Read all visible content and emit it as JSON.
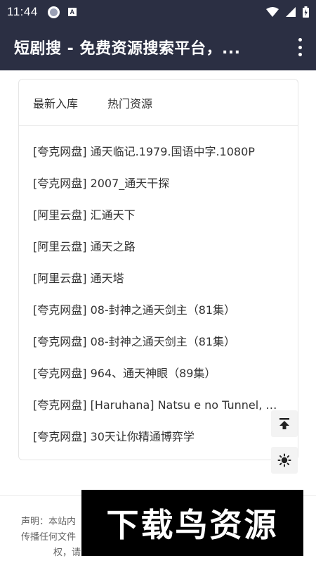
{
  "status_bar": {
    "time": "11:44"
  },
  "app_bar": {
    "title": "短剧搜 - 免费资源搜索平台，..."
  },
  "tabs": [
    {
      "label": "最新入库"
    },
    {
      "label": "热门资源"
    }
  ],
  "results": [
    {
      "label": "[夸克网盘] 通天临记.1979.国语中字.1080P"
    },
    {
      "label": "[夸克网盘] 2007_通天干探"
    },
    {
      "label": "[阿里云盘] 汇通天下"
    },
    {
      "label": "[阿里云盘] 通天之路"
    },
    {
      "label": "[阿里云盘] 通天塔"
    },
    {
      "label": "[夸克网盘] 08-封神之通天剑主（81集）"
    },
    {
      "label": "[夸克网盘] 08-封神之通天剑主（81集）"
    },
    {
      "label": "[夸克网盘] 964、通天神眼（89集）"
    },
    {
      "label": "[夸克网盘] [Haruhana] Natsu e no Tunnel, Sa..."
    },
    {
      "label": "[夸克网盘] 30天让你精通博弈学"
    }
  ],
  "footer": {
    "line1": "声明：本站内",
    "line2": "传播任何文件",
    "line3": "权，请"
  },
  "watermark": {
    "text": "下载鸟资源"
  },
  "colors": {
    "header_bg": "#2b2f43",
    "accent": "#ffffff"
  },
  "icons": {
    "back_to_top": "arrow-up-to-line-icon",
    "theme": "sun-icon",
    "menu": "more-vert-icon"
  }
}
